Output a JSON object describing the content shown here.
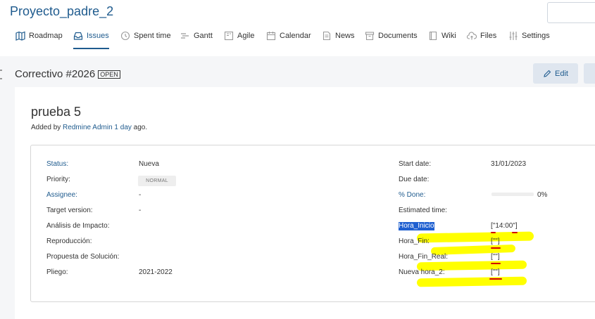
{
  "project": {
    "title": "Proyecto_padre_2"
  },
  "nav": [
    {
      "label": "Roadmap",
      "icon": "map-icon"
    },
    {
      "label": "Issues",
      "icon": "inbox-icon",
      "active": true
    },
    {
      "label": "Spent time",
      "icon": "clock-icon"
    },
    {
      "label": "Gantt",
      "icon": "gantt-icon"
    },
    {
      "label": "Agile",
      "icon": "board-icon"
    },
    {
      "label": "Calendar",
      "icon": "calendar-icon"
    },
    {
      "label": "News",
      "icon": "news-icon"
    },
    {
      "label": "Documents",
      "icon": "archive-icon"
    },
    {
      "label": "Wiki",
      "icon": "book-icon"
    },
    {
      "label": "Files",
      "icon": "cloud-upload-icon"
    },
    {
      "label": "Settings",
      "icon": "sliders-icon"
    }
  ],
  "issue": {
    "title": "Correctivo #2026",
    "status_badge": "OPEN",
    "edit_label": "Edit",
    "subject": "prueba 5",
    "added_prefix": "Added by",
    "author": "Redmine Admin",
    "age": "1 day",
    "added_suffix": "ago."
  },
  "attributes": {
    "left": [
      {
        "label": "Status:",
        "value": "Nueva",
        "link": true
      },
      {
        "label": "Priority:",
        "value": "NORMAL",
        "badge": true
      },
      {
        "label": "Assignee:",
        "value": "-",
        "link": true
      },
      {
        "label": "Target version:",
        "value": "-"
      },
      {
        "label": "Análisis de Impacto:",
        "value": ""
      },
      {
        "label": "Reproducción:",
        "value": ""
      },
      {
        "label": "Propuesta de Solución:",
        "value": ""
      },
      {
        "label": "Pliego:",
        "value": "2021-2022"
      }
    ],
    "right": [
      {
        "label": "Start date:",
        "value": "31/01/2023"
      },
      {
        "label": "Due date:",
        "value": ""
      },
      {
        "label": "% Done:",
        "value": "0%",
        "link": true,
        "progress": 0
      },
      {
        "label": "Estimated time:",
        "value": ""
      },
      {
        "label": "Hora_Inicio",
        "value": "[\"14:00\"]",
        "selected": true
      },
      {
        "label": "Hora_Fin:",
        "value": "[\"\"]"
      },
      {
        "label": "Hora_Fin_Real:",
        "value": "[\"\"]"
      },
      {
        "label": "Nueva hora_2:",
        "value": "[\"\"]"
      }
    ]
  },
  "colors": {
    "link": "#1f5b8e",
    "highlight": "#ffff00",
    "annotation": "#d20000",
    "selection": "#2060d0"
  }
}
